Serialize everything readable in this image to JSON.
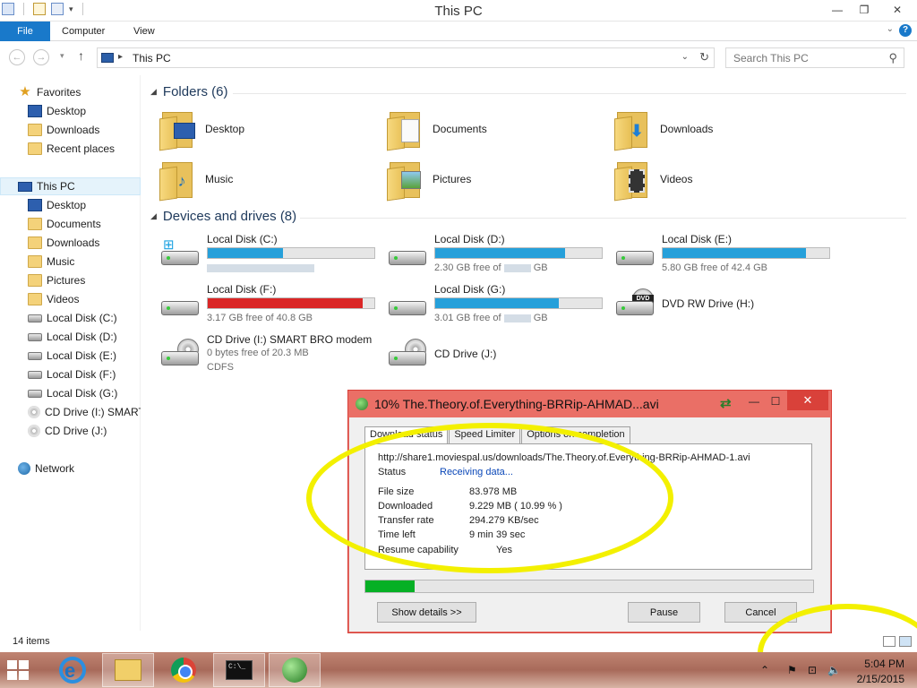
{
  "window": {
    "title": "This PC",
    "min": "—",
    "restore": "❐",
    "close": "✕"
  },
  "ribbon": {
    "file": "File",
    "computer": "Computer",
    "view": "View",
    "help": "?",
    "caret": "⌄"
  },
  "address": {
    "path": "This PC",
    "search_placeholder": "Search This PC"
  },
  "nav": {
    "favorites": "Favorites",
    "fav_items": [
      "Desktop",
      "Downloads",
      "Recent places"
    ],
    "this_pc": "This PC",
    "pc_items": [
      "Desktop",
      "Documents",
      "Downloads",
      "Music",
      "Pictures",
      "Videos",
      "Local Disk (C:)",
      "Local Disk (D:)",
      "Local Disk (E:)",
      "Local Disk (F:)",
      "Local Disk (G:)",
      "CD Drive (I:) SMART",
      "CD Drive (J:)"
    ],
    "network": "Network"
  },
  "folders": {
    "header": "Folders (6)",
    "items": [
      "Desktop",
      "Documents",
      "Downloads",
      "Music",
      "Pictures",
      "Videos"
    ]
  },
  "drives": {
    "header": "Devices and drives (8)",
    "c": {
      "name": "Local Disk (C:)",
      "used_fraction": 0.45
    },
    "d": {
      "name": "Local Disk (D:)",
      "free_text": "2.30 GB free of",
      "unit": "GB",
      "used_fraction": 0.78
    },
    "e": {
      "name": "Local Disk (E:)",
      "free_text": "5.80 GB free of 42.4 GB",
      "used_fraction": 0.86
    },
    "f": {
      "name": "Local Disk (F:)",
      "free_text": "3.17 GB free of 40.8 GB",
      "used_fraction": 0.93
    },
    "g": {
      "name": "Local Disk (G:)",
      "free_text": "3.01 GB free of",
      "unit": "GB",
      "used_fraction": 0.74
    },
    "h": {
      "name": "DVD RW Drive (H:)",
      "label": "DVD"
    },
    "i": {
      "name": "CD Drive (I:) SMART BRO modem",
      "free_text": "0 bytes free of 20.3 MB",
      "fs": "CDFS"
    },
    "j": {
      "name": "CD Drive (J:)"
    }
  },
  "status": {
    "count": "14 items"
  },
  "idm": {
    "title": "10% The.Theory.of.Everything-BRRip-AHMAD...avi",
    "min": "—",
    "max": "☐",
    "close": "✕",
    "tabs": [
      "Download status",
      "Speed Limiter",
      "Options on completion"
    ],
    "url": "http://share1.moviespal.us/downloads/The.Theory.of.Everything-BRRip-AHMAD-1.avi",
    "status_label": "Status",
    "status_value": "Receiving data...",
    "file_size_label": "File size",
    "file_size_value": "83.978  MB",
    "downloaded_label": "Downloaded",
    "downloaded_value": "9.229  MB  ( 10.99 % )",
    "rate_label": "Transfer rate",
    "rate_value": "294.279  KB/sec",
    "time_label": "Time left",
    "time_value": "9 min 39 sec",
    "resume_label": "Resume capability",
    "resume_value": "Yes",
    "progress_fraction": 0.1099,
    "show_details": "Show details >>",
    "pause": "Pause",
    "cancel": "Cancel"
  },
  "taskbar": {
    "cmd_text": "C:\\_",
    "time": "5:04 PM",
    "date": "2/15/2015"
  },
  "colors": {
    "accent": "#1979ca",
    "bar_blue": "#26a0da",
    "bar_red": "#da2626",
    "annotation": "#f3f000",
    "idm_title": "#ea6f66"
  }
}
